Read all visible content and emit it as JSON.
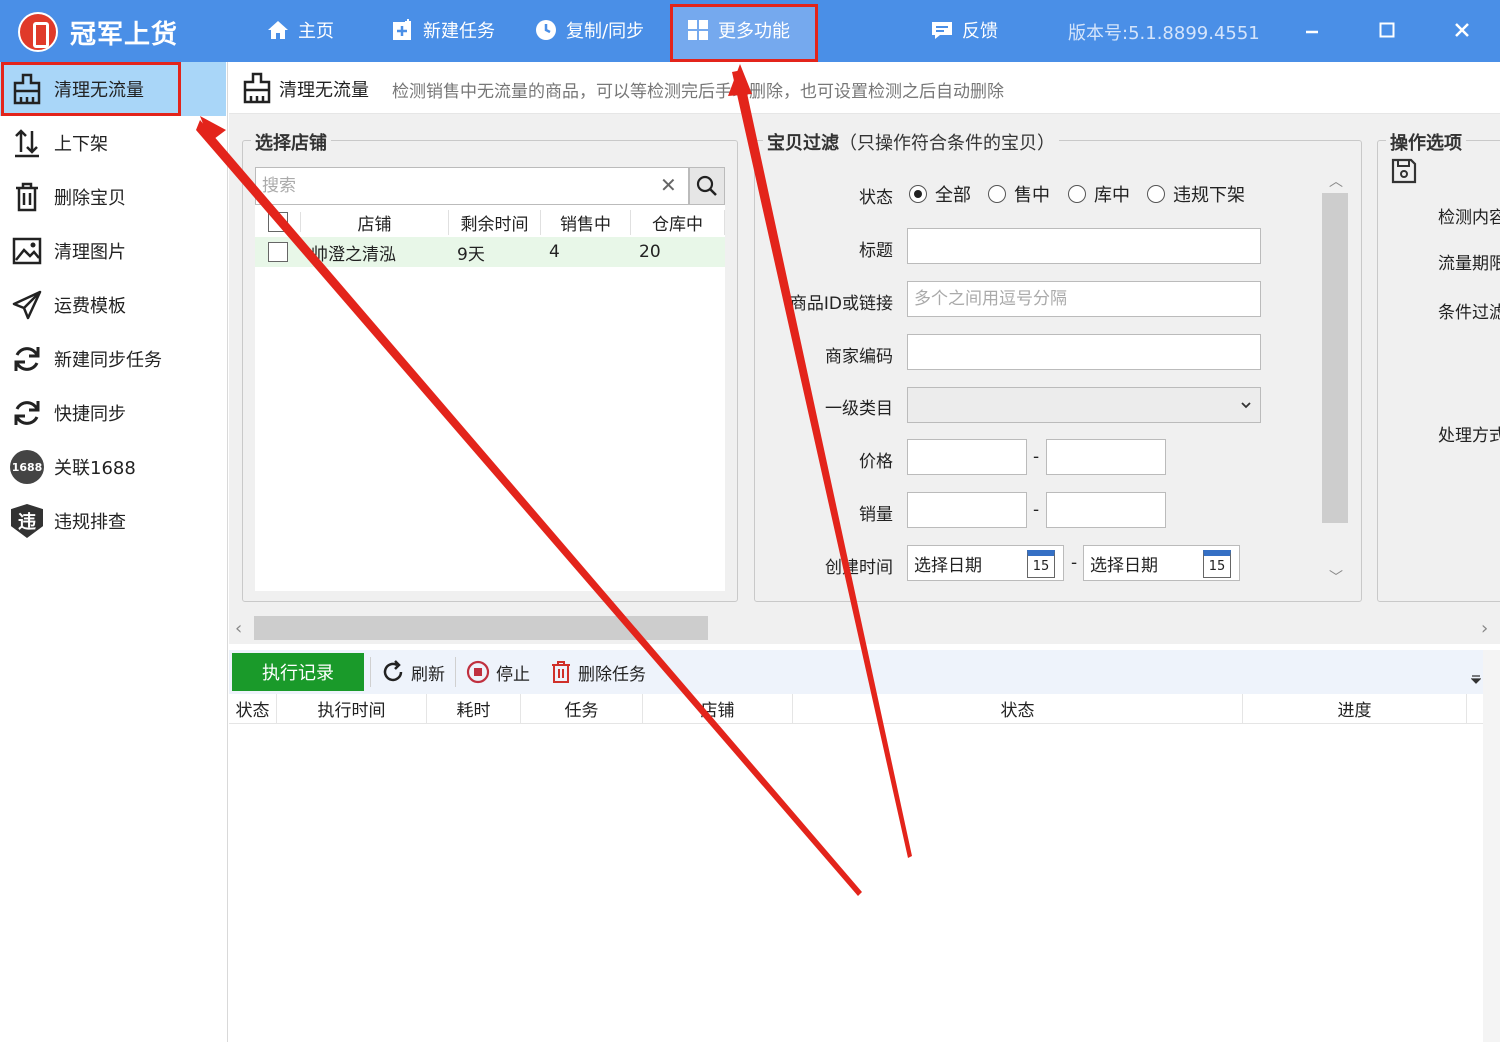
{
  "app": {
    "title": "冠军上货",
    "version": "版本号:5.1.8899.4551"
  },
  "nav": {
    "home": "主页",
    "new_task": "新建任务",
    "copy_sync": "复制/同步",
    "more": "更多功能",
    "feedback": "反馈"
  },
  "sidebar": {
    "items": [
      {
        "label": "清理无流量",
        "icon": "broom-icon"
      },
      {
        "label": "上下架",
        "icon": "shelf-updown-icon"
      },
      {
        "label": "删除宝贝",
        "icon": "trash-icon"
      },
      {
        "label": "清理图片",
        "icon": "image-icon"
      },
      {
        "label": "运费模板",
        "icon": "send-icon"
      },
      {
        "label": "新建同步任务",
        "icon": "sync-icon"
      },
      {
        "label": "快捷同步",
        "icon": "sync-icon"
      },
      {
        "label": "关联1688",
        "icon": "badge-1688-icon",
        "badge": "1688"
      },
      {
        "label": "违规排查",
        "icon": "violation-shield-icon",
        "badge": "违"
      }
    ]
  },
  "header": {
    "title": "清理无流量",
    "description": "检测销售中无流量的商品，可以等检测完后手动删除，也可设置检测之后自动删除"
  },
  "store_panel": {
    "title": "选择店铺",
    "search_placeholder": "搜索",
    "columns": [
      "店铺",
      "剩余时间",
      "销售中",
      "仓库中"
    ],
    "rows": [
      {
        "store": "帅澄之清泓",
        "remaining": "9天",
        "on_sale": "4",
        "in_stock": "20"
      }
    ]
  },
  "filter_panel": {
    "title": "宝贝过滤",
    "subtitle": "（只操作符合条件的宝贝）",
    "status_label": "状态",
    "status_options": [
      "全部",
      "售中",
      "库中",
      "违规下架"
    ],
    "status_selected": "全部",
    "title_label": "标题",
    "title_value": "",
    "item_id_label": "商品ID或链接",
    "item_id_placeholder": "多个之间用逗号分隔",
    "merchant_code_label": "商家编码",
    "category_label": "一级类目",
    "price_label": "价格",
    "sales_label": "销量",
    "range_sep": "-",
    "created_label": "创建时间",
    "date_placeholder": "选择日期",
    "calendar_day": "15"
  },
  "ops_panel": {
    "title": "操作选项",
    "labels": [
      "检测内容",
      "流量期限",
      "条件过滤",
      "处理方式"
    ]
  },
  "lower": {
    "tab": "执行记录",
    "refresh": "刷新",
    "stop": "停止",
    "delete_task": "删除任务",
    "columns": [
      "状态",
      "执行时间",
      "耗时",
      "任务",
      "店铺",
      "状态",
      "进度"
    ]
  },
  "colors": {
    "topbar": "#4a8fe7",
    "active_side": "#a9d6f8",
    "highlight_border": "#e3241b",
    "exec_tab": "#1a9a2a"
  }
}
